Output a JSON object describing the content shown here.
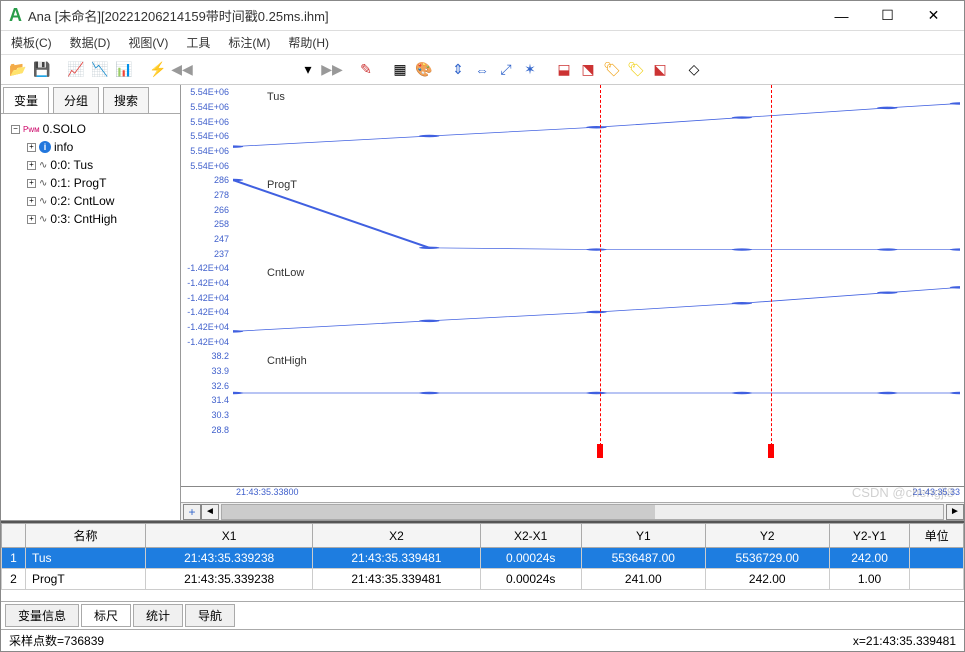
{
  "window": {
    "app_logo": "A",
    "title": "Ana  [未命名][20221206214159带时间戳0.25ms.ihm]",
    "min": "—",
    "max": "☐",
    "close": "✕"
  },
  "menu": {
    "template": "模板(C)",
    "data": "数据(D)",
    "view": "视图(V)",
    "tools": "工具",
    "annot": "标注(M)",
    "help": "帮助(H)"
  },
  "sidebar": {
    "tabs": {
      "vars": "变量",
      "groups": "分组",
      "search": "搜索"
    },
    "root": "0.SOLO",
    "items": [
      "info",
      "0:0: Tus",
      "0:1: ProgT",
      "0:2: CntLow",
      "0:3: CntHigh"
    ]
  },
  "chart_data": [
    {
      "name": "Tus",
      "type": "line",
      "yticks": [
        "5.54E+06",
        "5.54E+06",
        "5.54E+06",
        "5.54E+06",
        "5.54E+06",
        "5.54E+06"
      ],
      "points": [
        [
          0.0,
          0.7
        ],
        [
          0.27,
          0.58
        ],
        [
          0.5,
          0.48
        ],
        [
          0.7,
          0.37
        ],
        [
          0.9,
          0.26
        ],
        [
          1.0,
          0.21
        ]
      ]
    },
    {
      "name": "ProgT",
      "type": "line",
      "yticks": [
        "286",
        "278",
        "266",
        "258",
        "247",
        "237"
      ],
      "points": [
        [
          0.0,
          0.08
        ],
        [
          0.27,
          0.85
        ],
        [
          0.5,
          0.87
        ],
        [
          0.7,
          0.87
        ],
        [
          0.9,
          0.87
        ],
        [
          1.0,
          0.87
        ]
      ]
    },
    {
      "name": "CntLow",
      "type": "line",
      "yticks": [
        "-1.42E+04",
        "-1.42E+04",
        "-1.42E+04",
        "-1.42E+04",
        "-1.42E+04",
        "-1.42E+04"
      ],
      "points": [
        [
          0.0,
          0.8
        ],
        [
          0.27,
          0.68
        ],
        [
          0.5,
          0.58
        ],
        [
          0.7,
          0.48
        ],
        [
          0.9,
          0.36
        ],
        [
          1.0,
          0.3
        ]
      ]
    },
    {
      "name": "CntHigh",
      "type": "line",
      "yticks": [
        "38.2",
        "33.9",
        "32.6",
        "31.4",
        "30.3",
        "28.8"
      ],
      "points": [
        [
          0.0,
          0.5
        ],
        [
          0.27,
          0.5
        ],
        [
          0.5,
          0.5
        ],
        [
          0.7,
          0.5
        ],
        [
          0.9,
          0.5
        ],
        [
          1.0,
          0.5
        ]
      ]
    }
  ],
  "xaxis": {
    "left": "21:43:35.33800",
    "right": "21:43:35.33"
  },
  "table": {
    "headers": [
      "",
      "名称",
      "X1",
      "X2",
      "X2-X1",
      "Y1",
      "Y2",
      "Y2-Y1",
      "单位"
    ],
    "rows": [
      {
        "idx": "1",
        "name": "Tus",
        "x1": "21:43:35.339238",
        "x2": "21:43:35.339481",
        "dx": "0.00024s",
        "y1": "5536487.00",
        "y2": "5536729.00",
        "dy": "242.00",
        "unit": ""
      },
      {
        "idx": "2",
        "name": "ProgT",
        "x1": "21:43:35.339238",
        "x2": "21:43:35.339481",
        "dx": "0.00024s",
        "y1": "241.00",
        "y2": "242.00",
        "dy": "1.00",
        "unit": ""
      }
    ]
  },
  "bottom_tabs": {
    "varinfo": "变量信息",
    "ruler": "标尺",
    "stats": "统计",
    "nav": "导航"
  },
  "status": {
    "left": "采样点数=736839",
    "right": "x=21:43:35.339481"
  },
  "watermark": "CSDN @chengjl8"
}
